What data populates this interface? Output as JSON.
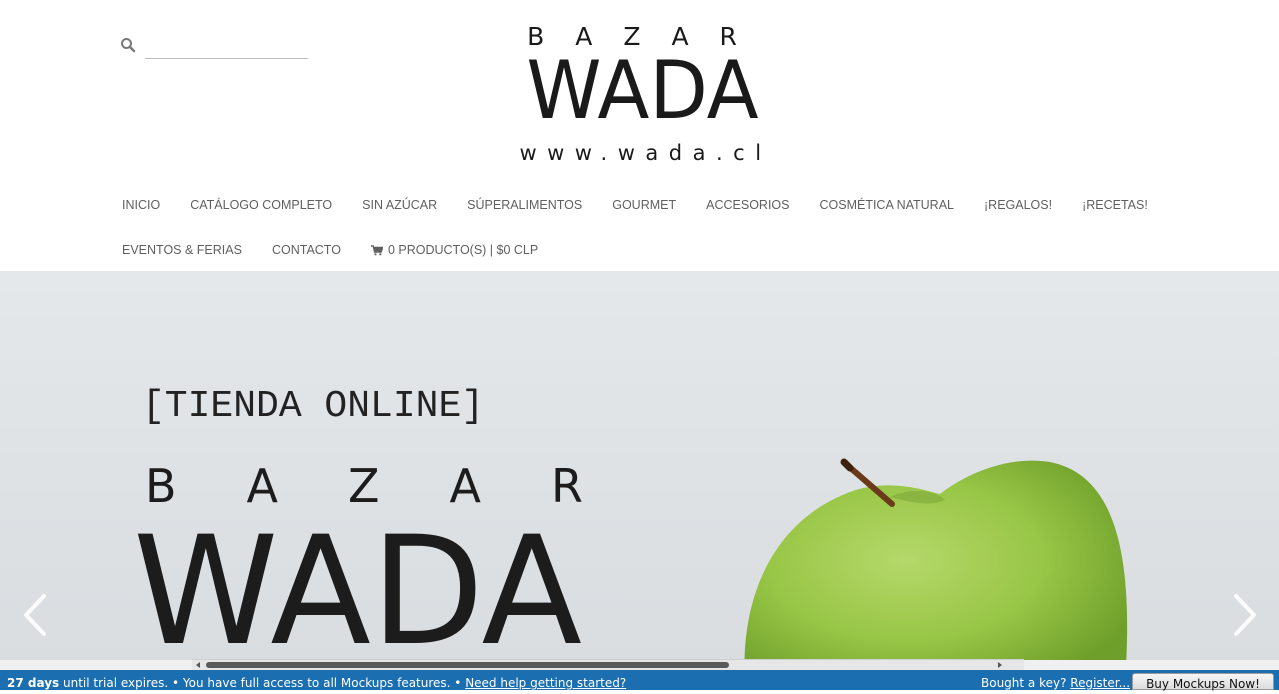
{
  "search": {
    "placeholder": "",
    "value": "",
    "icon": "search-icon"
  },
  "logo": {
    "line1": "BAZAR",
    "line2": "WADA",
    "line3": "www.wada.cl"
  },
  "nav": {
    "row1": [
      "INICIO",
      "CATÁLOGO COMPLETO",
      "SIN AZÚCAR",
      "SÚPERALIMENTOS",
      "GOURMET",
      "ACCESORIOS",
      "COSMÉTICA NATURAL",
      "¡REGALOS!",
      "¡RECETAS!"
    ],
    "row2": [
      "EVENTOS & FERIAS",
      "CONTACTO"
    ],
    "cart": "0 PRODUCTO(S) | $0 CLP"
  },
  "hero": {
    "tagline": "[TIENDA ONLINE]",
    "brand_top": "BAZAR",
    "brand_main": "WADA",
    "colors": {
      "apple": "#8fbf3a",
      "background": "#e1e5e8"
    }
  },
  "trial_bar": {
    "days": "27 days",
    "message": " until trial expires. • You have full access to all Mockups features. • ",
    "help_link": "Need help getting started?",
    "bought": "Bought a key? ",
    "register_link": "Register...",
    "buy_button": "Buy Mockups Now!",
    "color": "#1b6fb1"
  }
}
